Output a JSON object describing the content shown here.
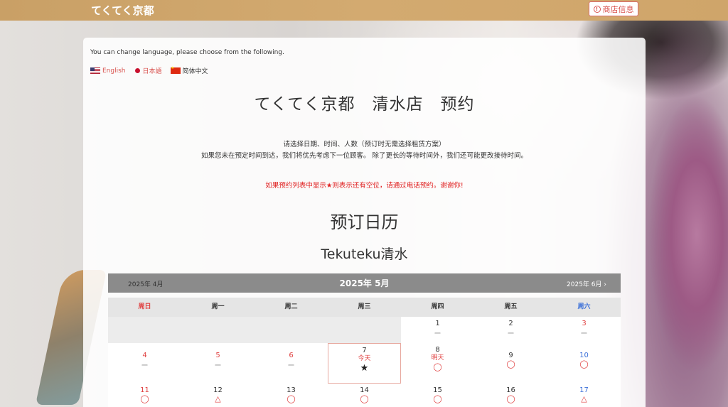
{
  "header": {
    "brand": "てくてく京都",
    "shop_info_label": "商店信息"
  },
  "language": {
    "prompt": "You can change language, please choose from the following.",
    "options": [
      {
        "label": "English"
      },
      {
        "label": "日本語"
      },
      {
        "label": "简体中文"
      }
    ]
  },
  "main": {
    "title": "てくてく京都　清水店　预约",
    "desc_line1": "请选择日期、时间、人数（预订时无需选择租赁方案）",
    "desc_line2": "如果您未在预定时间到达，我们将优先考虑下一位顾客。 除了更长的等待时间外，我们还可能更改接待时间。",
    "notice": "如果预约列表中显示★则表示还有空位，请通过电话预约。谢谢你!",
    "calendar_heading": "预订日历",
    "shop_name": "Tekuteku清水"
  },
  "calendar": {
    "prev_label": "2025年 4月",
    "current_label": "2025年 5月",
    "next_label": "2025年 6月",
    "weekdays": [
      "周日",
      "周一",
      "周二",
      "周三",
      "周四",
      "周五",
      "周六"
    ],
    "today_label": "今天",
    "tomorrow_label": "明天",
    "marks": {
      "dash": "ー",
      "circle": "◯",
      "triangle": "△",
      "star": "★"
    },
    "week1": [
      {
        "day": "",
        "mark": ""
      },
      {
        "day": "",
        "mark": ""
      },
      {
        "day": "",
        "mark": ""
      },
      {
        "day": "",
        "mark": ""
      },
      {
        "day": "1",
        "mark": "ー"
      },
      {
        "day": "2",
        "mark": "ー"
      },
      {
        "day": "3",
        "mark": "ー"
      }
    ],
    "week2": [
      {
        "day": "4",
        "mark": "ー"
      },
      {
        "day": "5",
        "mark": "ー"
      },
      {
        "day": "6",
        "mark": "ー"
      },
      {
        "day": "7",
        "mark": "★"
      },
      {
        "day": "8",
        "mark": "◯"
      },
      {
        "day": "9",
        "mark": "◯"
      },
      {
        "day": "10",
        "mark": "◯"
      }
    ],
    "week3": [
      {
        "day": "11",
        "mark": "◯"
      },
      {
        "day": "12",
        "mark": "△"
      },
      {
        "day": "13",
        "mark": "◯"
      },
      {
        "day": "14",
        "mark": "◯"
      },
      {
        "day": "15",
        "mark": "◯"
      },
      {
        "day": "16",
        "mark": "◯"
      },
      {
        "day": "17",
        "mark": "△"
      }
    ]
  }
}
